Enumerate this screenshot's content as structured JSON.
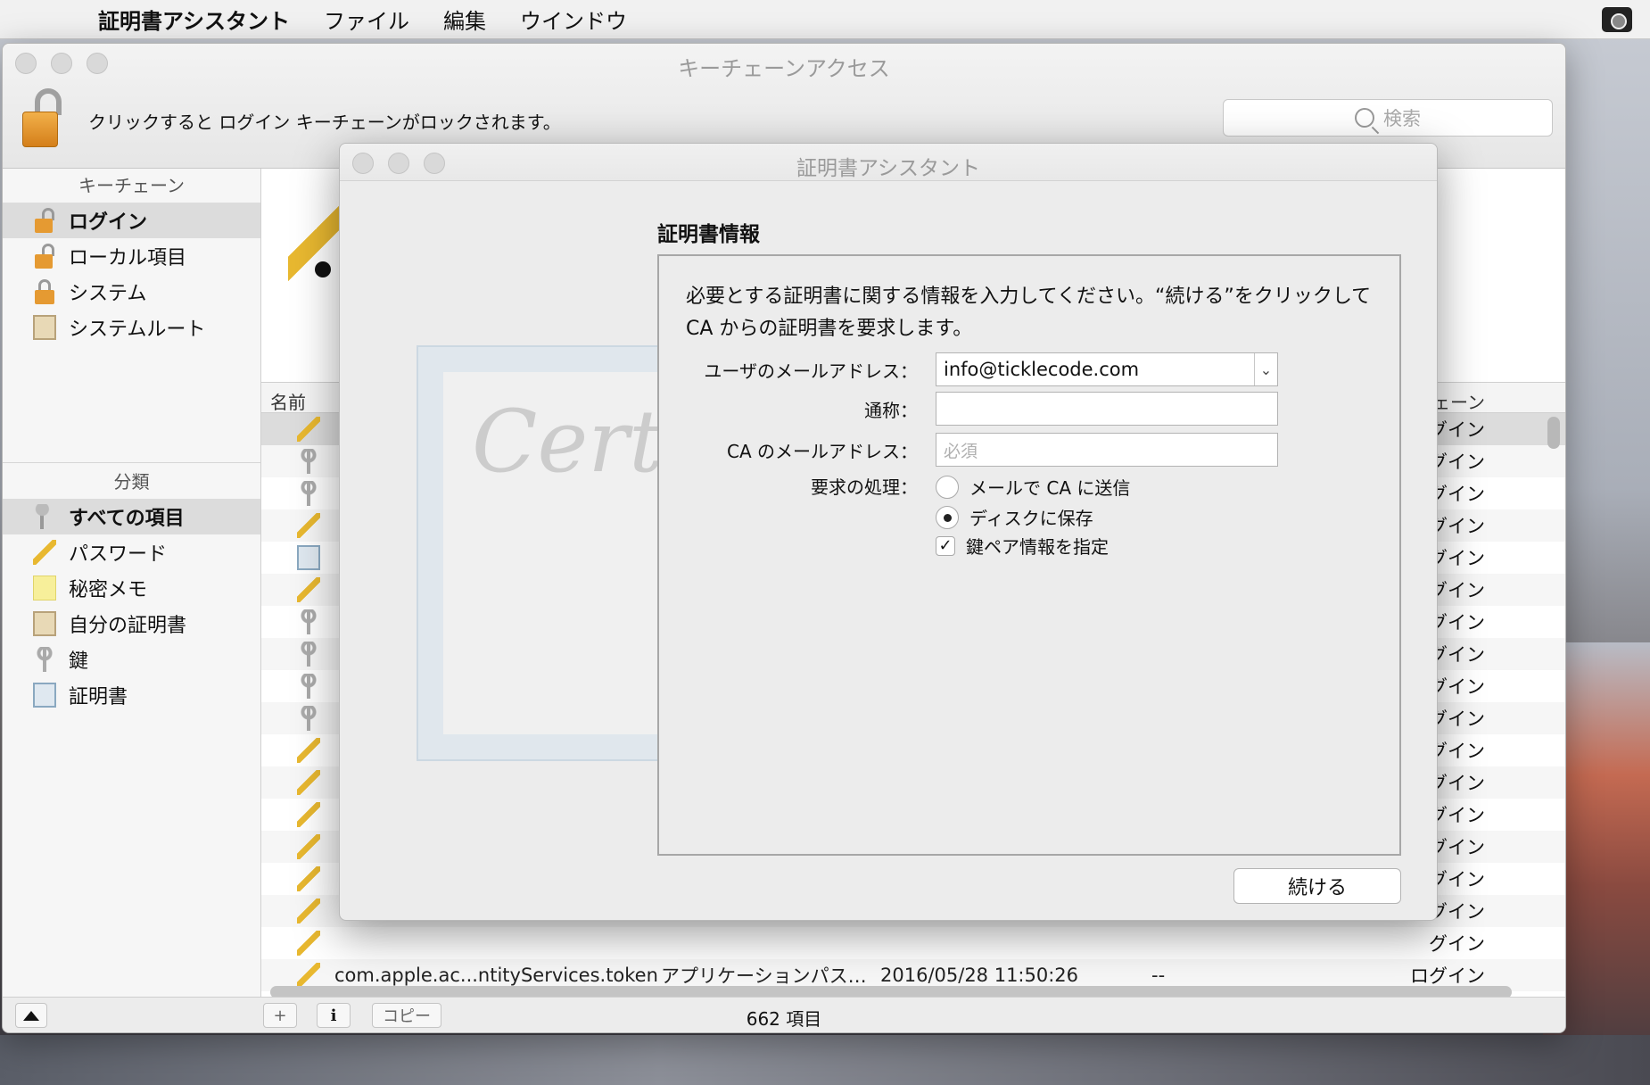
{
  "menubar": {
    "app_name": "証明書アシスタント",
    "items": [
      "ファイル",
      "編集",
      "ウインドウ"
    ]
  },
  "window": {
    "title": "キーチェーンアクセス",
    "lock_message": "クリックすると ログイン キーチェーンがロックされます。",
    "search_placeholder": "検索"
  },
  "sidebar": {
    "keychains_header": "キーチェーン",
    "keychains": [
      {
        "label": "ログイン",
        "icon": "lock-open-icon",
        "selected": true
      },
      {
        "label": "ローカル項目",
        "icon": "lock-open-icon",
        "selected": false
      },
      {
        "label": "システム",
        "icon": "lock-icon",
        "selected": false
      },
      {
        "label": "システムルート",
        "icon": "certificate-folder-icon",
        "selected": false
      }
    ],
    "category_header": "分類",
    "categories": [
      {
        "label": "すべての項目",
        "icon": "keys-icon",
        "selected": true
      },
      {
        "label": "パスワード",
        "icon": "pencil-icon",
        "selected": false
      },
      {
        "label": "秘密メモ",
        "icon": "note-icon",
        "selected": false
      },
      {
        "label": "自分の証明書",
        "icon": "my-certificate-icon",
        "selected": false
      },
      {
        "label": "鍵",
        "icon": "key-icon",
        "selected": false
      },
      {
        "label": "証明書",
        "icon": "certificate-icon",
        "selected": false
      }
    ]
  },
  "list": {
    "col_name": "名前",
    "col_keychain": "ーチェーン",
    "rows": [
      {
        "icon": "pencil-icon",
        "right": "グイン"
      },
      {
        "icon": "key-icon",
        "right": "グイン"
      },
      {
        "icon": "key-icon",
        "right": "グイン"
      },
      {
        "icon": "pencil-icon",
        "right": "グイン"
      },
      {
        "icon": "certificate-icon",
        "right": "グイン"
      },
      {
        "icon": "pencil-icon",
        "right": "グイン"
      },
      {
        "icon": "key-icon",
        "right": "グイン"
      },
      {
        "icon": "key-icon",
        "right": "グイン"
      },
      {
        "icon": "key-icon",
        "right": "グイン"
      },
      {
        "icon": "key-icon",
        "right": "グイン"
      },
      {
        "icon": "pencil-icon",
        "right": "グイン"
      },
      {
        "icon": "pencil-icon",
        "right": "グイン"
      },
      {
        "icon": "pencil-icon",
        "right": "グイン"
      },
      {
        "icon": "pencil-icon",
        "right": "グイン"
      },
      {
        "icon": "pencil-icon",
        "right": "グイン"
      },
      {
        "icon": "pencil-icon",
        "right": "グイン"
      },
      {
        "icon": "pencil-icon",
        "right": "グイン"
      }
    ],
    "last_row": {
      "name": "com.apple.ac...ntityServices.token",
      "kind": "アプリケーションパス…",
      "date": "2016/05/28 11:50:26",
      "expires": "--",
      "keychain": "ログイン"
    }
  },
  "bottombar": {
    "add": "+",
    "info": "i",
    "copy": "コピー",
    "count": "662 項目"
  },
  "dialog": {
    "title": "証明書アシスタント",
    "heading": "証明書情報",
    "intro": "必要とする証明書に関する情報を入力してください。“続ける”をクリックして CA からの証明書を要求します。",
    "watermark_text": "Certificate",
    "email_label": "ユーザのメールアドレス：",
    "email_value": "info@ticklecode.com",
    "common_name_label": "通称：",
    "common_name_value": "",
    "ca_email_label": "CA のメールアドレス：",
    "ca_email_placeholder": "必須",
    "request_label": "要求の処理：",
    "option_email": "メールで CA に送信",
    "option_email_selected": false,
    "option_disk": "ディスクに保存",
    "option_disk_selected": true,
    "option_keypair": "鍵ペア情報を指定",
    "option_keypair_checked": true,
    "continue": "続ける"
  }
}
